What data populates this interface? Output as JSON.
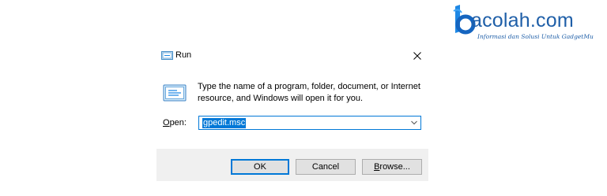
{
  "watermark": {
    "brand": "acolah.com",
    "tagline": "Informasi dan Solusi Untuk GadgetMu",
    "color": "#1f5fa8"
  },
  "dialog": {
    "title": "Run",
    "title_icon": "run-icon",
    "close_icon": "close-icon",
    "description": "Type the name of a program, folder, document, or Internet resource, and Windows will open it for you.",
    "open_label_mnemonic": "O",
    "open_label_rest": "pen:",
    "open_value": "gpedit.msc",
    "buttons": {
      "ok": "OK",
      "cancel": "Cancel",
      "browse_mnemonic": "B",
      "browse_rest": "rowse..."
    },
    "accent_color": "#0078d7"
  }
}
